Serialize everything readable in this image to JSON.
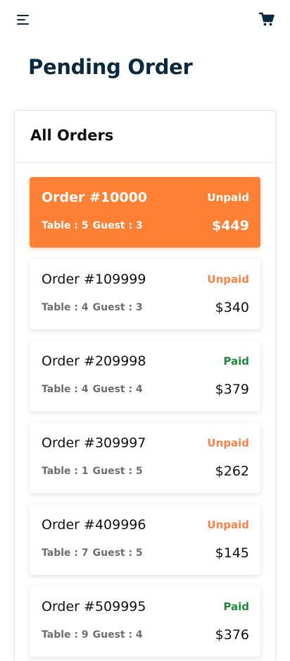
{
  "header": {
    "menu_icon": "hamburger-menu-icon",
    "cart_icon": "shopping-cart-icon"
  },
  "page": {
    "title": "Pending Order"
  },
  "panel": {
    "title": "All Orders"
  },
  "colors": {
    "accent": "#fd8035",
    "title": "#0b2a3f",
    "unpaid": "#f6834a",
    "paid": "#1c8a3c"
  },
  "orders": [
    {
      "id": "Order #10000",
      "status": "Unpaid",
      "table": "Table : 5",
      "guest": "Guest : 3",
      "price": "$449",
      "active": true
    },
    {
      "id": "Order #109999",
      "status": "Unpaid",
      "table": "Table : 4",
      "guest": "Guest : 3",
      "price": "$340",
      "active": false
    },
    {
      "id": "Order #209998",
      "status": "Paid",
      "table": "Table : 4",
      "guest": "Guest : 4",
      "price": "$379",
      "active": false
    },
    {
      "id": "Order #309997",
      "status": "Unpaid",
      "table": "Table : 1",
      "guest": "Guest : 5",
      "price": "$262",
      "active": false
    },
    {
      "id": "Order #409996",
      "status": "Unpaid",
      "table": "Table : 7",
      "guest": "Guest : 5",
      "price": "$145",
      "active": false
    },
    {
      "id": "Order #509995",
      "status": "Paid",
      "table": "Table : 9",
      "guest": "Guest : 4",
      "price": "$376",
      "active": false
    }
  ]
}
